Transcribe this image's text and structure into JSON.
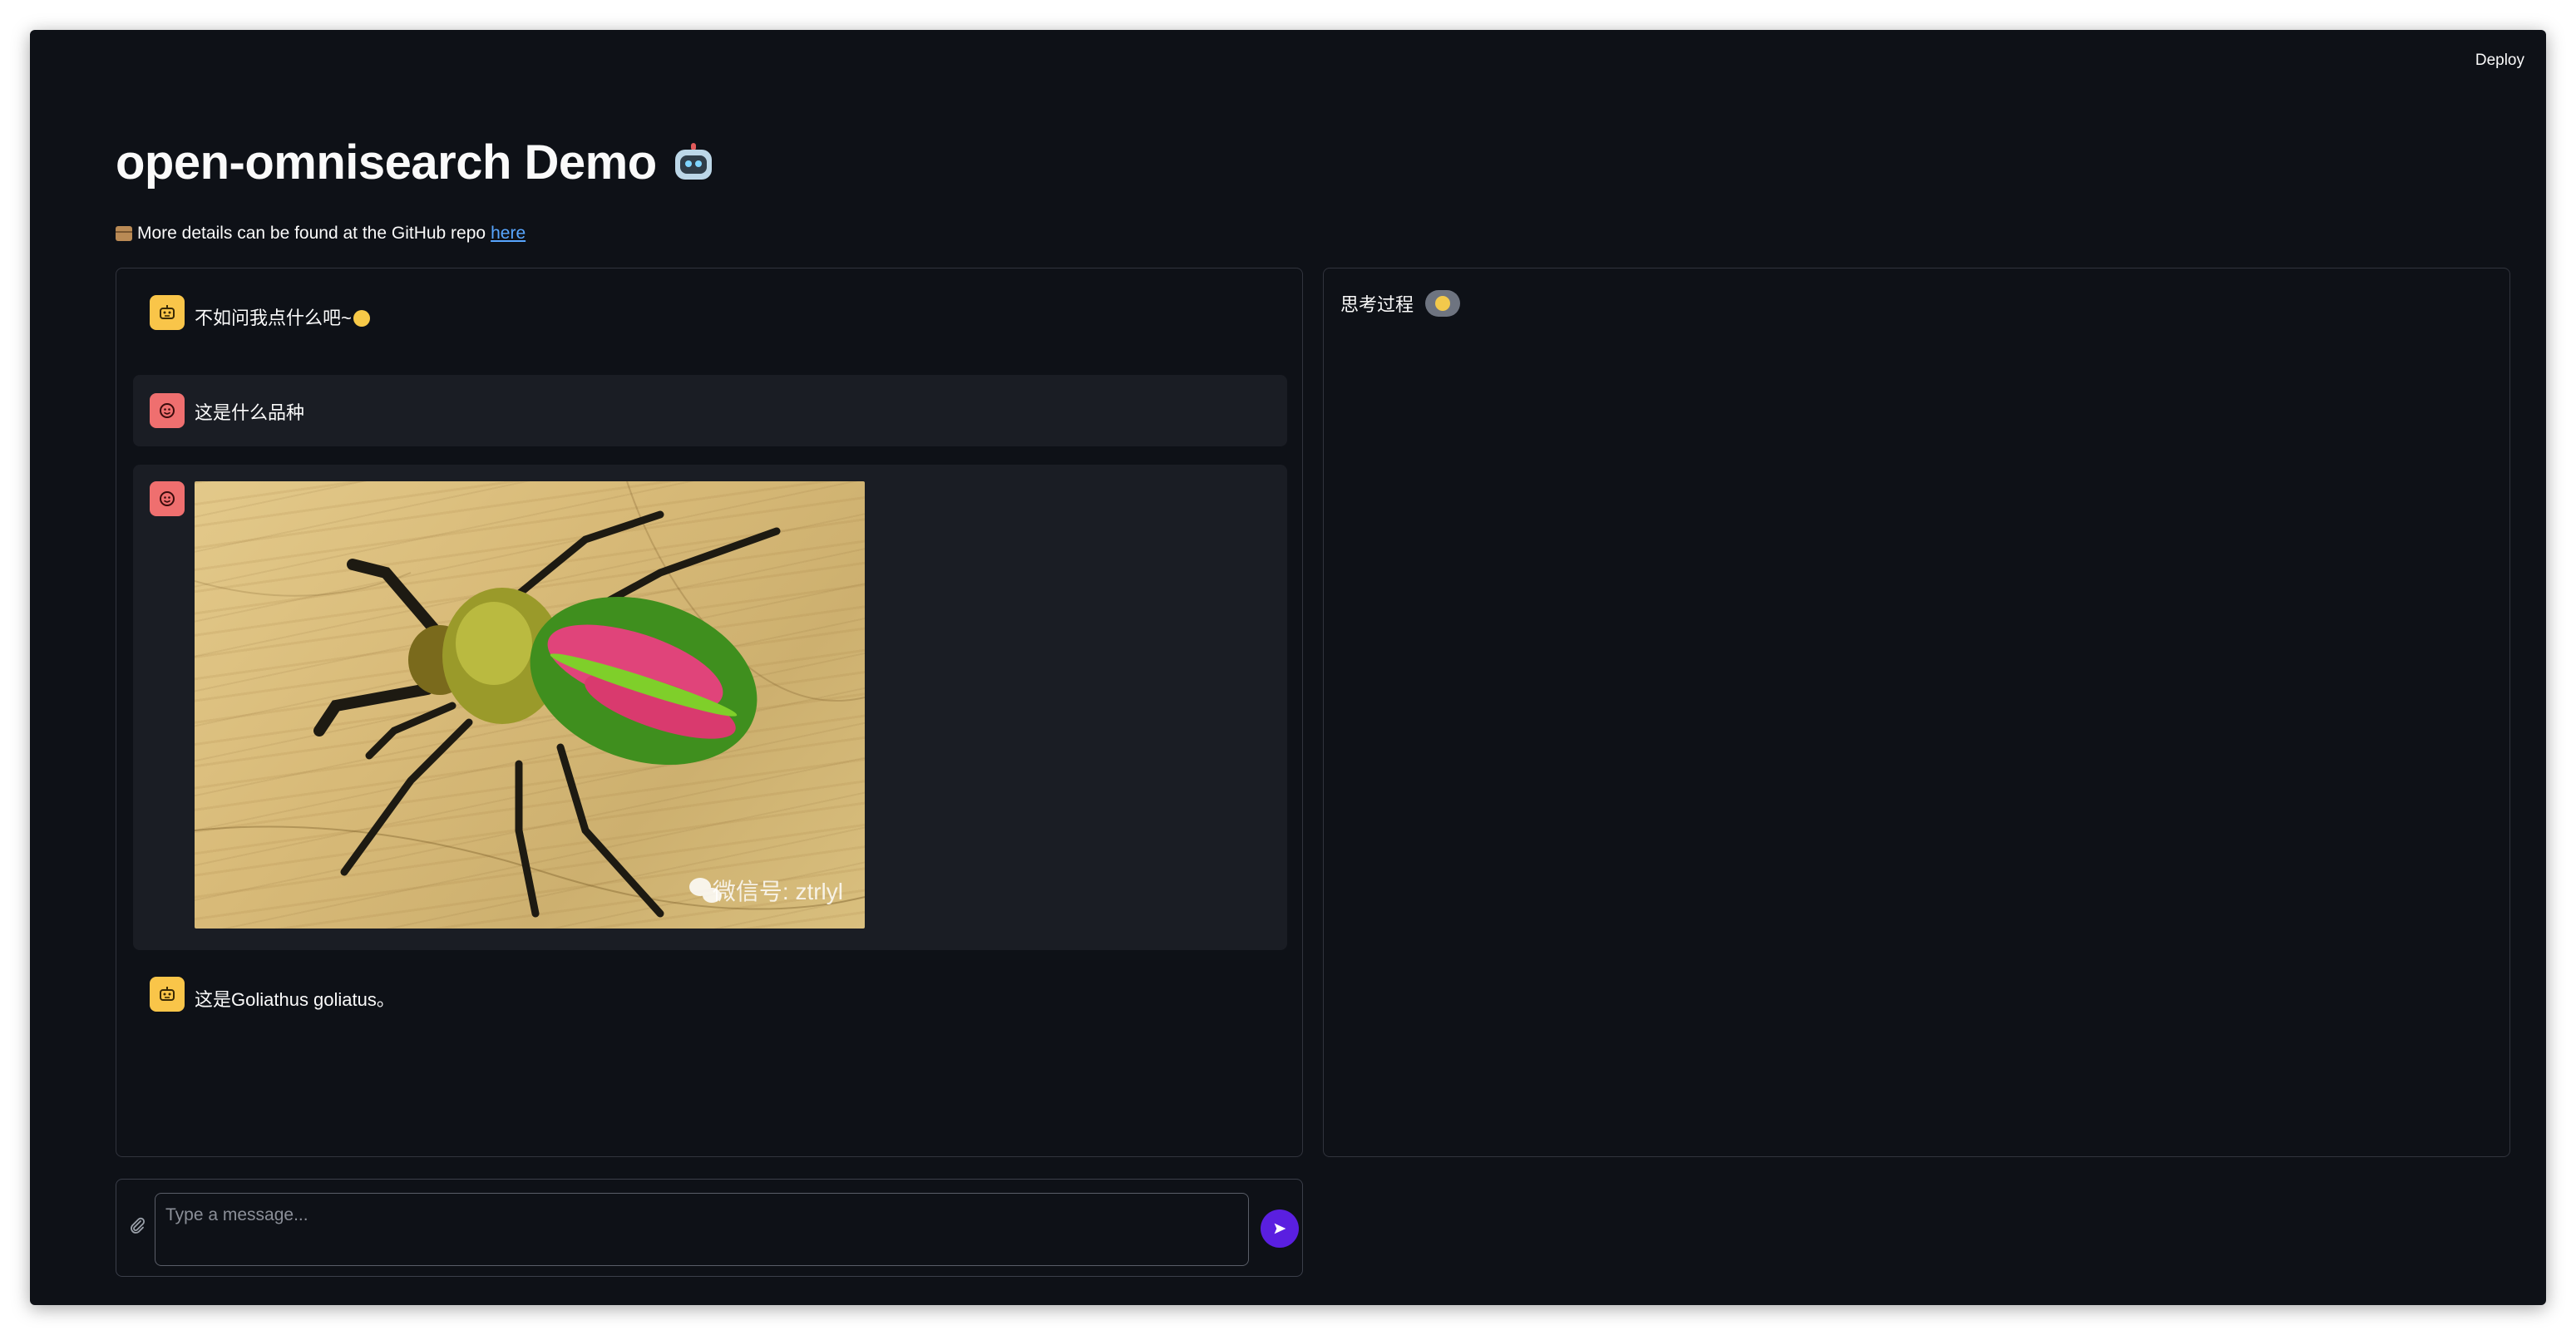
{
  "app": {
    "deploy_label": "Deploy",
    "title": "open-omnisearch Demo",
    "subtitle_text": "More details can be found at the GitHub repo",
    "subtitle_link": "here"
  },
  "chat": {
    "messages": [
      {
        "role": "assistant",
        "text": "不如问我点什么吧~"
      },
      {
        "role": "user",
        "text": "这是什么品种"
      },
      {
        "role": "user",
        "image": "beetle-photo",
        "watermark": "微信号: ztrlyl"
      },
      {
        "role": "assistant",
        "text": "这是Goliathus goliatus。"
      }
    ]
  },
  "thinking": {
    "title": "思考过程"
  },
  "input": {
    "placeholder": "Type a message..."
  },
  "colors": {
    "background": "#0e1117",
    "user_message_bg": "#1a1d24",
    "bot_avatar": "#f9c549",
    "user_avatar": "#ef6f6f",
    "send_button": "#5a1fe0",
    "link": "#58a6ff"
  },
  "icons": {
    "title_emoji": "robot-icon",
    "subtitle_emoji": "package-icon",
    "bot_avatar": "robot-face-icon",
    "user_avatar": "smiley-face-icon",
    "thinking_emoji": "thinking-face-icon",
    "attach": "paperclip-icon",
    "send": "send-arrow-icon"
  }
}
